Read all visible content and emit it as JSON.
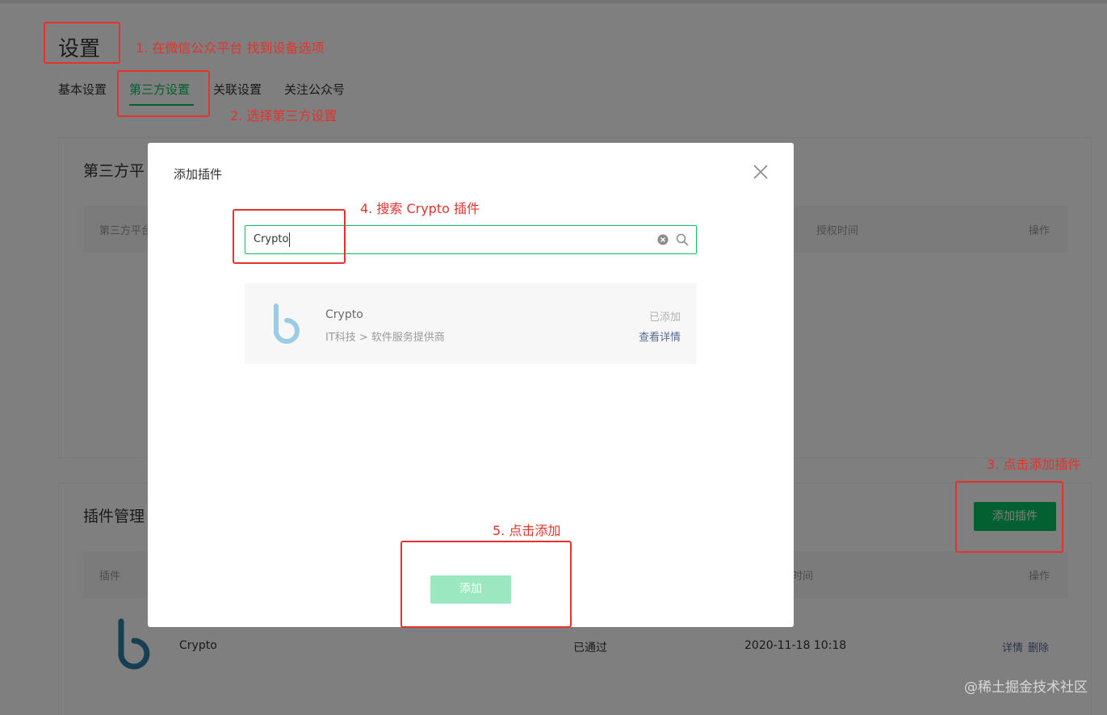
{
  "page": {
    "title": "设置",
    "tabs": [
      "基本设置",
      "第三方设置",
      "关联设置",
      "关注公众号"
    ],
    "active_tab": "第三方设置"
  },
  "third_party_card": {
    "title": "第三方平",
    "columns": [
      "第三方平台",
      "授权时间",
      "操作"
    ]
  },
  "plugin_card": {
    "title": "插件管理",
    "add_button": "添加插件",
    "columns": [
      "插件",
      "时间",
      "操作"
    ],
    "rows": [
      {
        "name": "Crypto",
        "status": "已通过",
        "time": "2020-11-18 10:18",
        "actions": [
          "详情",
          "删除"
        ]
      }
    ]
  },
  "modal": {
    "title": "添加插件",
    "search_value": "Crypto",
    "result": {
      "name": "Crypto",
      "category": "IT科技 > 软件服务提供商",
      "status": "已添加",
      "detail_link": "查看详情"
    },
    "confirm_button": "添加"
  },
  "annotations": [
    "1. 在微信公众平台 找到设备选项",
    "2. 选择第三方设置",
    "3. 点击添加插件",
    "4. 搜索 Crypto 插件",
    "5. 点击添加"
  ],
  "watermark": "@稀土掘金技术社区",
  "icons": {
    "logo": "crypto-b-logo-icon",
    "close": "close-icon",
    "clear": "clear-icon",
    "search": "search-icon"
  },
  "colors": {
    "brand_green": "#07c160",
    "disabled_green": "#9be7bf",
    "annotation_red": "#e5322d",
    "link_blue": "#576b95"
  }
}
